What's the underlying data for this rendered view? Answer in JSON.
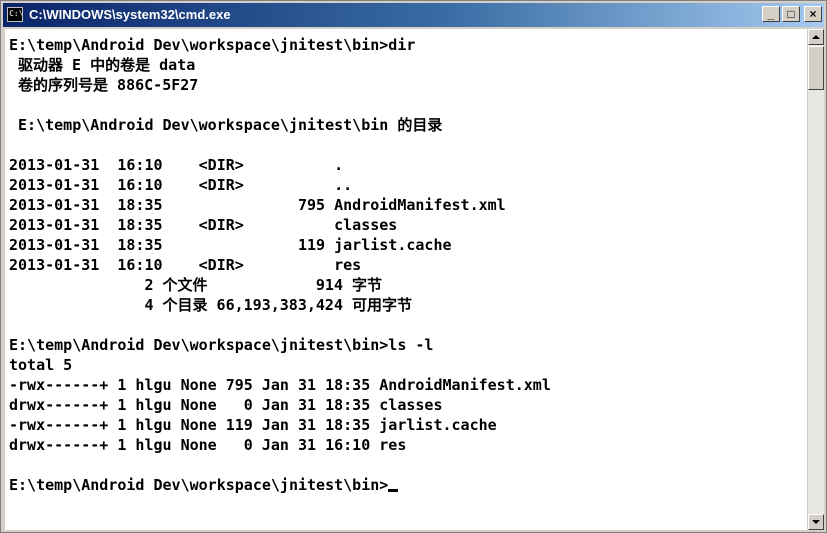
{
  "window": {
    "title": "C:\\WINDOWS\\system32\\cmd.exe",
    "icon_label": "C:\\",
    "controls": {
      "minimize": "_",
      "maximize": "□",
      "close": "×"
    }
  },
  "console": {
    "lines": [
      "E:\\temp\\Android Dev\\workspace\\jnitest\\bin>dir",
      " 驱动器 E 中的卷是 data",
      " 卷的序列号是 886C-5F27",
      "",
      " E:\\temp\\Android Dev\\workspace\\jnitest\\bin 的目录",
      "",
      "2013-01-31  16:10    <DIR>          .",
      "2013-01-31  16:10    <DIR>          ..",
      "2013-01-31  18:35               795 AndroidManifest.xml",
      "2013-01-31  18:35    <DIR>          classes",
      "2013-01-31  18:35               119 jarlist.cache",
      "2013-01-31  16:10    <DIR>          res",
      "               2 个文件            914 字节",
      "               4 个目录 66,193,383,424 可用字节",
      "",
      "E:\\temp\\Android Dev\\workspace\\jnitest\\bin>ls -l",
      "total 5",
      "-rwx------+ 1 hlgu None 795 Jan 31 18:35 AndroidManifest.xml",
      "drwx------+ 1 hlgu None   0 Jan 31 18:35 classes",
      "-rwx------+ 1 hlgu None 119 Jan 31 18:35 jarlist.cache",
      "drwx------+ 1 hlgu None   0 Jan 31 16:10 res",
      "",
      "E:\\temp\\Android Dev\\workspace\\jnitest\\bin>"
    ]
  }
}
